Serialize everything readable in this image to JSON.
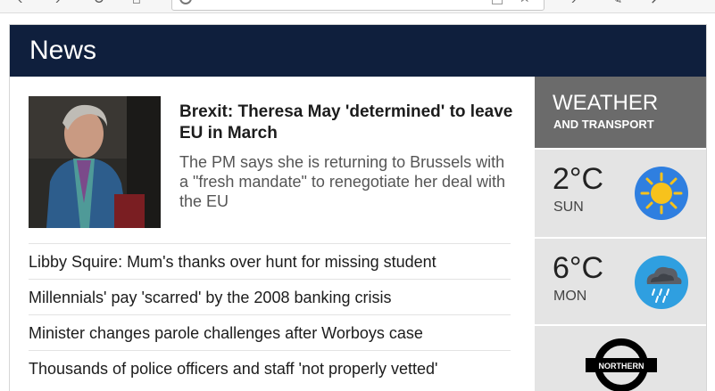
{
  "header": {
    "title": "News"
  },
  "featured": {
    "headline": "Brexit: Theresa May 'determined' to leave EU in March",
    "summary": "The PM says she is returning to Brussels with a \"fresh mandate\" to renegotiate her deal with the EU"
  },
  "stories": [
    "Libby Squire: Mum's thanks over hunt for missing student",
    "Millennials' pay 'scarred' by the 2008 banking crisis",
    "Minister changes parole challenges after Worboys case",
    "Thousands of police officers and staff 'not properly vetted'"
  ],
  "weather": {
    "title": "WEATHER",
    "subtitle": "AND TRANSPORT",
    "days": [
      {
        "temp": "2°C",
        "day": "SUN",
        "icon": "sun-icon"
      },
      {
        "temp": "6°C",
        "day": "MON",
        "icon": "rain-cloud-icon"
      }
    ],
    "transport_label": "NORTHERN"
  },
  "colors": {
    "header_bg": "#0f1f3d",
    "weather_head_bg": "#6b6b6b",
    "tile_bg": "#e4e4e4",
    "icon_circle": "#2f7fe0",
    "sun": "#f7c21c"
  }
}
